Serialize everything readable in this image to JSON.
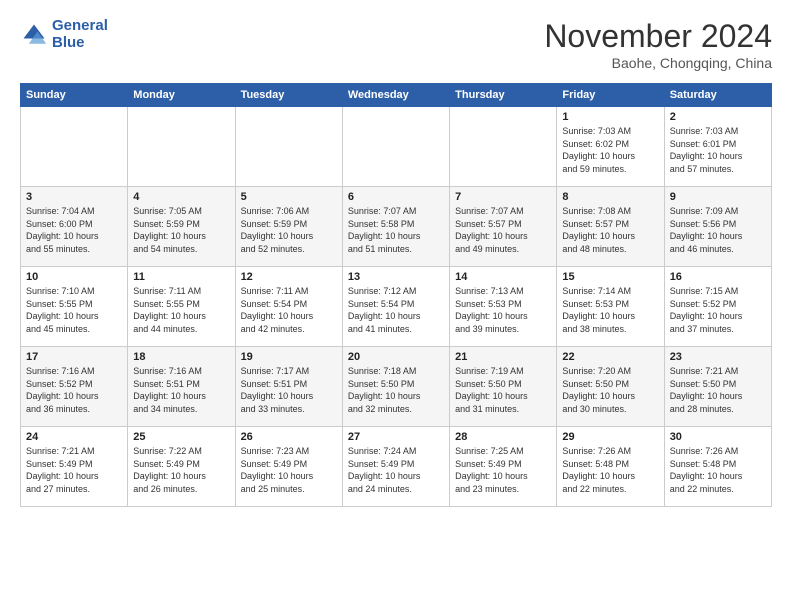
{
  "header": {
    "logo_line1": "General",
    "logo_line2": "Blue",
    "month": "November 2024",
    "location": "Baohe, Chongqing, China"
  },
  "weekdays": [
    "Sunday",
    "Monday",
    "Tuesday",
    "Wednesday",
    "Thursday",
    "Friday",
    "Saturday"
  ],
  "weeks": [
    [
      {
        "day": "",
        "info": ""
      },
      {
        "day": "",
        "info": ""
      },
      {
        "day": "",
        "info": ""
      },
      {
        "day": "",
        "info": ""
      },
      {
        "day": "",
        "info": ""
      },
      {
        "day": "1",
        "info": "Sunrise: 7:03 AM\nSunset: 6:02 PM\nDaylight: 10 hours\nand 59 minutes."
      },
      {
        "day": "2",
        "info": "Sunrise: 7:03 AM\nSunset: 6:01 PM\nDaylight: 10 hours\nand 57 minutes."
      }
    ],
    [
      {
        "day": "3",
        "info": "Sunrise: 7:04 AM\nSunset: 6:00 PM\nDaylight: 10 hours\nand 55 minutes."
      },
      {
        "day": "4",
        "info": "Sunrise: 7:05 AM\nSunset: 5:59 PM\nDaylight: 10 hours\nand 54 minutes."
      },
      {
        "day": "5",
        "info": "Sunrise: 7:06 AM\nSunset: 5:59 PM\nDaylight: 10 hours\nand 52 minutes."
      },
      {
        "day": "6",
        "info": "Sunrise: 7:07 AM\nSunset: 5:58 PM\nDaylight: 10 hours\nand 51 minutes."
      },
      {
        "day": "7",
        "info": "Sunrise: 7:07 AM\nSunset: 5:57 PM\nDaylight: 10 hours\nand 49 minutes."
      },
      {
        "day": "8",
        "info": "Sunrise: 7:08 AM\nSunset: 5:57 PM\nDaylight: 10 hours\nand 48 minutes."
      },
      {
        "day": "9",
        "info": "Sunrise: 7:09 AM\nSunset: 5:56 PM\nDaylight: 10 hours\nand 46 minutes."
      }
    ],
    [
      {
        "day": "10",
        "info": "Sunrise: 7:10 AM\nSunset: 5:55 PM\nDaylight: 10 hours\nand 45 minutes."
      },
      {
        "day": "11",
        "info": "Sunrise: 7:11 AM\nSunset: 5:55 PM\nDaylight: 10 hours\nand 44 minutes."
      },
      {
        "day": "12",
        "info": "Sunrise: 7:11 AM\nSunset: 5:54 PM\nDaylight: 10 hours\nand 42 minutes."
      },
      {
        "day": "13",
        "info": "Sunrise: 7:12 AM\nSunset: 5:54 PM\nDaylight: 10 hours\nand 41 minutes."
      },
      {
        "day": "14",
        "info": "Sunrise: 7:13 AM\nSunset: 5:53 PM\nDaylight: 10 hours\nand 39 minutes."
      },
      {
        "day": "15",
        "info": "Sunrise: 7:14 AM\nSunset: 5:53 PM\nDaylight: 10 hours\nand 38 minutes."
      },
      {
        "day": "16",
        "info": "Sunrise: 7:15 AM\nSunset: 5:52 PM\nDaylight: 10 hours\nand 37 minutes."
      }
    ],
    [
      {
        "day": "17",
        "info": "Sunrise: 7:16 AM\nSunset: 5:52 PM\nDaylight: 10 hours\nand 36 minutes."
      },
      {
        "day": "18",
        "info": "Sunrise: 7:16 AM\nSunset: 5:51 PM\nDaylight: 10 hours\nand 34 minutes."
      },
      {
        "day": "19",
        "info": "Sunrise: 7:17 AM\nSunset: 5:51 PM\nDaylight: 10 hours\nand 33 minutes."
      },
      {
        "day": "20",
        "info": "Sunrise: 7:18 AM\nSunset: 5:50 PM\nDaylight: 10 hours\nand 32 minutes."
      },
      {
        "day": "21",
        "info": "Sunrise: 7:19 AM\nSunset: 5:50 PM\nDaylight: 10 hours\nand 31 minutes."
      },
      {
        "day": "22",
        "info": "Sunrise: 7:20 AM\nSunset: 5:50 PM\nDaylight: 10 hours\nand 30 minutes."
      },
      {
        "day": "23",
        "info": "Sunrise: 7:21 AM\nSunset: 5:50 PM\nDaylight: 10 hours\nand 28 minutes."
      }
    ],
    [
      {
        "day": "24",
        "info": "Sunrise: 7:21 AM\nSunset: 5:49 PM\nDaylight: 10 hours\nand 27 minutes."
      },
      {
        "day": "25",
        "info": "Sunrise: 7:22 AM\nSunset: 5:49 PM\nDaylight: 10 hours\nand 26 minutes."
      },
      {
        "day": "26",
        "info": "Sunrise: 7:23 AM\nSunset: 5:49 PM\nDaylight: 10 hours\nand 25 minutes."
      },
      {
        "day": "27",
        "info": "Sunrise: 7:24 AM\nSunset: 5:49 PM\nDaylight: 10 hours\nand 24 minutes."
      },
      {
        "day": "28",
        "info": "Sunrise: 7:25 AM\nSunset: 5:49 PM\nDaylight: 10 hours\nand 23 minutes."
      },
      {
        "day": "29",
        "info": "Sunrise: 7:26 AM\nSunset: 5:48 PM\nDaylight: 10 hours\nand 22 minutes."
      },
      {
        "day": "30",
        "info": "Sunrise: 7:26 AM\nSunset: 5:48 PM\nDaylight: 10 hours\nand 22 minutes."
      }
    ]
  ]
}
